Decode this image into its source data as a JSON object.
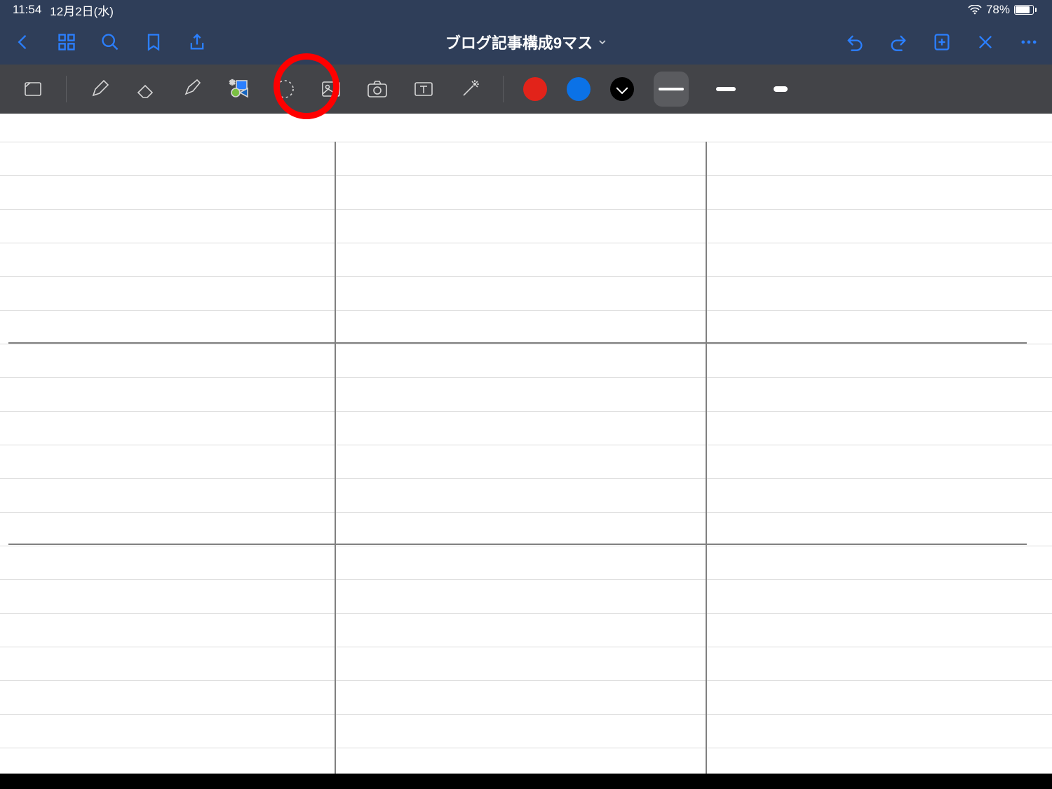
{
  "status": {
    "time": "11:54",
    "date": "12月2日(水)",
    "battery_pct": "78%"
  },
  "app_bar": {
    "title": "ブログ記事構成9マス"
  },
  "toolbar": {
    "colors": {
      "0": "#e2231a",
      "1": "#0b72e7",
      "2": "#000000"
    },
    "stroke_selected": 0
  },
  "annotation": {
    "target": "shapes-tool"
  }
}
